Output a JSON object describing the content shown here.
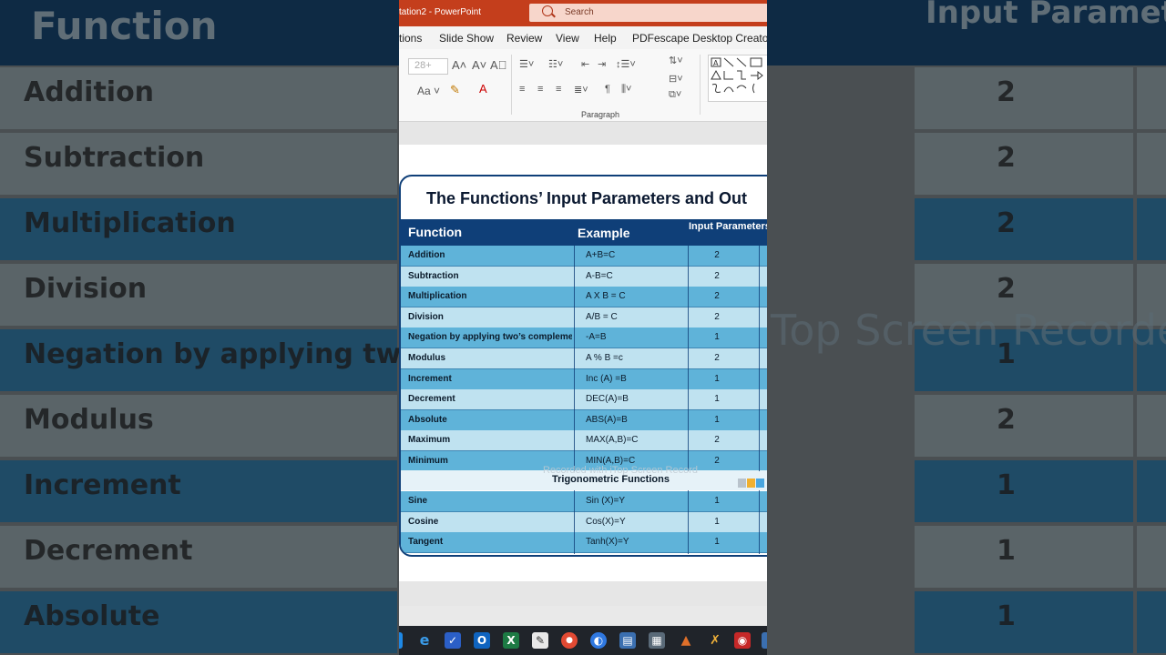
{
  "background": {
    "header_left": "Function",
    "header_right": "Input Parameters",
    "rows": [
      {
        "label": "Addition",
        "value": "2",
        "tone": "light"
      },
      {
        "label": "Subtraction",
        "value": "2",
        "tone": "light"
      },
      {
        "label": "Multiplication",
        "value": "2",
        "tone": "dark"
      },
      {
        "label": "Division",
        "value": "2",
        "tone": "light"
      },
      {
        "label": "Negation by applying two’s co",
        "value": "1",
        "tone": "dark"
      },
      {
        "label": "Modulus",
        "value": "2",
        "tone": "light"
      },
      {
        "label": "Increment",
        "value": "1",
        "tone": "dark"
      },
      {
        "label": "Decrement",
        "value": "1",
        "tone": "light"
      },
      {
        "label": "Absolute",
        "value": "1",
        "tone": "dark"
      }
    ],
    "watermark": "Top Screen Recorde"
  },
  "window": {
    "title": "tation2 - PowerPoint",
    "search_placeholder": "Search"
  },
  "menu": {
    "items": [
      "tions",
      "Slide Show",
      "Review",
      "View",
      "Help",
      "PDFescape Desktop Creator"
    ]
  },
  "ribbon": {
    "font_size": "28+",
    "paragraph_label": "Paragraph"
  },
  "slide": {
    "title": "The Functions’ Input Parameters and Out",
    "headers": {
      "function": "Function",
      "example": "Example",
      "input": "Input Parameters"
    },
    "rows": [
      {
        "function": "Addition",
        "example": "A+B=C",
        "input": "2"
      },
      {
        "function": "Subtraction",
        "example": "A-B=C",
        "input": "2"
      },
      {
        "function": "Multiplication",
        "example": "A X B = C",
        "input": "2"
      },
      {
        "function": "Division",
        "example": "A/B = C",
        "input": "2"
      },
      {
        "function": "Negation by applying two’s complement",
        "example": "-A=B",
        "input": "1"
      },
      {
        "function": "Modulus",
        "example": "A % B =c",
        "input": "2"
      },
      {
        "function": "Increment",
        "example": "Inc (A) =B",
        "input": "1"
      },
      {
        "function": "Decrement",
        "example": "DEC(A)=B",
        "input": "1"
      },
      {
        "function": "Absolute",
        "example": "ABS(A)=B",
        "input": "1"
      },
      {
        "function": "Maximum",
        "example": "MAX(A,B)=C",
        "input": "2"
      },
      {
        "function": "Minimum",
        "example": "MIN(A,B)=C",
        "input": "2"
      }
    ],
    "section_title": "Trigonometric Functions",
    "trig_rows": [
      {
        "function": "Sine",
        "example": "Sin (X)=Y",
        "input": "1"
      },
      {
        "function": "Cosine",
        "example": "Cos(X)=Y",
        "input": "1"
      },
      {
        "function": "Tangent",
        "example": "Tanh(X)=Y",
        "input": "1"
      }
    ],
    "watermark": "Recorded with iTop Screen Record"
  },
  "taskbar": {
    "icons": [
      "edge-icon",
      "todo-icon",
      "outlook-icon",
      "excel-icon",
      "notepad-icon",
      "chrome-icon",
      "browser-icon",
      "network-icon",
      "calculator-icon",
      "matlab-icon",
      "tool-icon",
      "recorder-icon"
    ]
  },
  "colors": {
    "ppt_red": "#c43e1c",
    "table_header": "#0f3f78",
    "row_blue": "#5fb3d9",
    "row_pale": "#bfe2f0"
  }
}
